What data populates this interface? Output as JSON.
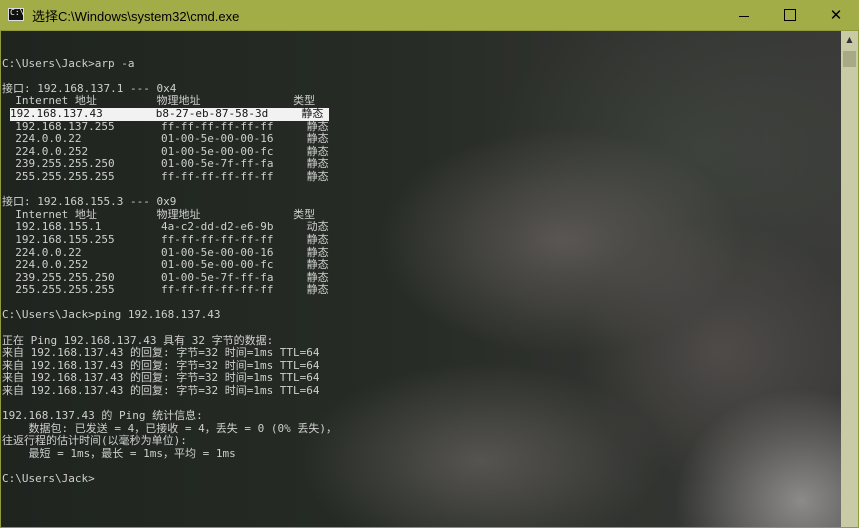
{
  "window": {
    "title": "选择C:\\Windows\\system32\\cmd.exe",
    "icon": "cmd-icon",
    "controls": {
      "minimize": "minimize-icon",
      "maximize": "maximize-icon",
      "close": "close-icon"
    }
  },
  "console": {
    "lines": [
      "",
      "C:\\Users\\Jack>arp -a",
      "",
      "接口: 192.168.137.1 --- 0x4",
      "  Internet 地址         物理地址              类型",
      "  192.168.137.43        b8-27-eb-87-58-3d     静态",
      "  192.168.137.255       ff-ff-ff-ff-ff-ff     静态",
      "  224.0.0.22            01-00-5e-00-00-16     静态",
      "  224.0.0.252           01-00-5e-00-00-fc     静态",
      "  239.255.255.250       01-00-5e-7f-ff-fa     静态",
      "  255.255.255.255       ff-ff-ff-ff-ff-ff     静态",
      "",
      "接口: 192.168.155.3 --- 0x9",
      "  Internet 地址         物理地址              类型",
      "  192.168.155.1         4a-c2-dd-d2-e6-9b     动态",
      "  192.168.155.255       ff-ff-ff-ff-ff-ff     静态",
      "  224.0.0.22            01-00-5e-00-00-16     静态",
      "  224.0.0.252           01-00-5e-00-00-fc     静态",
      "  239.255.255.250       01-00-5e-7f-ff-fa     静态",
      "  255.255.255.255       ff-ff-ff-ff-ff-ff     静态",
      "",
      "C:\\Users\\Jack>ping 192.168.137.43",
      "",
      "正在 Ping 192.168.137.43 具有 32 字节的数据:",
      "来自 192.168.137.43 的回复: 字节=32 时间=1ms TTL=64",
      "来自 192.168.137.43 的回复: 字节=32 时间=1ms TTL=64",
      "来自 192.168.137.43 的回复: 字节=32 时间=1ms TTL=64",
      "来自 192.168.137.43 的回复: 字节=32 时间=1ms TTL=64",
      "",
      "192.168.137.43 的 Ping 统计信息:",
      "    数据包: 已发送 = 4，已接收 = 4，丢失 = 0 (0% 丢失)，",
      "往返行程的估计时间(以毫秒为单位):",
      "    最短 = 1ms，最长 = 1ms，平均 = 1ms",
      "",
      "C:\\Users\\Jack>"
    ],
    "highlight_line": 5
  },
  "scrollbar": {
    "up_icon": "scroll-up-arrow-icon"
  }
}
